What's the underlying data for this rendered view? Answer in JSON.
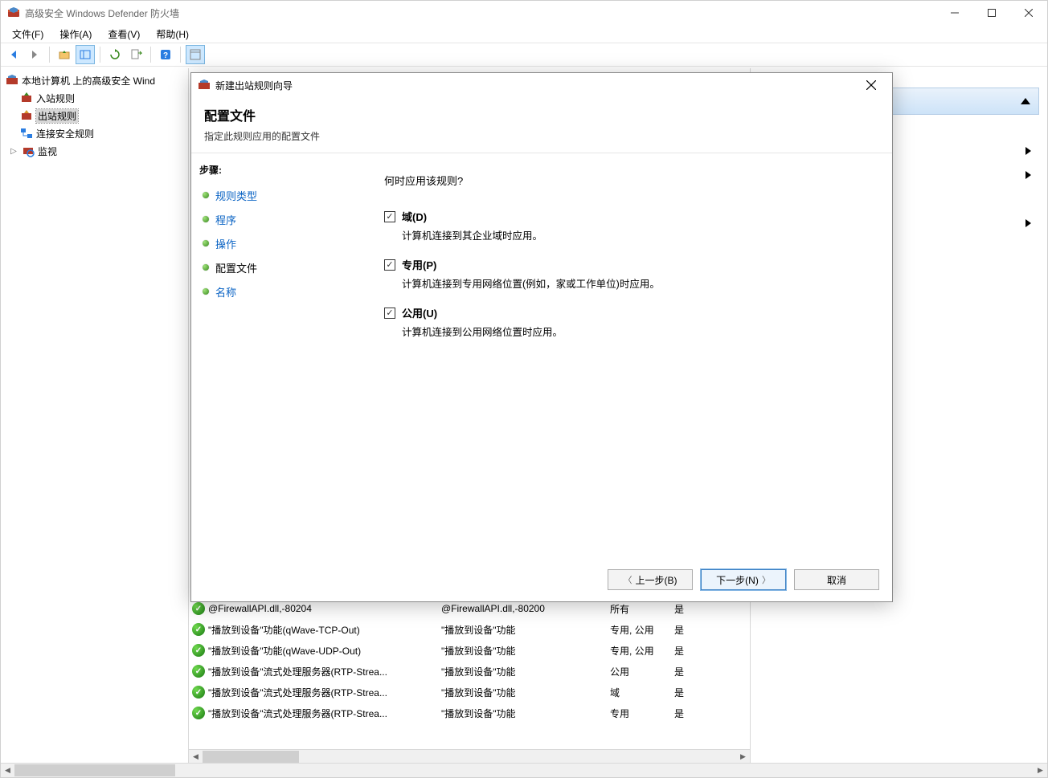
{
  "window": {
    "title": "高级安全 Windows Defender 防火墙"
  },
  "menu": {
    "file": "文件(F)",
    "action": "操作(A)",
    "view": "查看(V)",
    "help": "帮助(H)"
  },
  "tree": {
    "root": "本地计算机 上的高级安全 Wind",
    "inbound": "入站规则",
    "outbound": "出站规则",
    "connection": "连接安全规则",
    "monitor": "监视"
  },
  "rules": [
    {
      "name": "@FirewallAPI.dll,-80204",
      "group": "@FirewallAPI.dll,-80200",
      "profile": "所有",
      "enabled": "是"
    },
    {
      "name": "\"播放到设备\"功能(qWave-TCP-Out)",
      "group": "\"播放到设备\"功能",
      "profile": "专用, 公用",
      "enabled": "是"
    },
    {
      "name": "\"播放到设备\"功能(qWave-UDP-Out)",
      "group": "\"播放到设备\"功能",
      "profile": "专用, 公用",
      "enabled": "是"
    },
    {
      "name": "\"播放到设备\"流式处理服务器(RTP-Strea...",
      "group": "\"播放到设备\"功能",
      "profile": "公用",
      "enabled": "是"
    },
    {
      "name": "\"播放到设备\"流式处理服务器(RTP-Strea...",
      "group": "\"播放到设备\"功能",
      "profile": "域",
      "enabled": "是"
    },
    {
      "name": "\"播放到设备\"流式处理服务器(RTP-Strea...",
      "group": "\"播放到设备\"功能",
      "profile": "专用",
      "enabled": "是"
    }
  ],
  "wizard": {
    "title": "新建出站规则向导",
    "header": "配置文件",
    "subheader": "指定此规则应用的配置文件",
    "steps_title": "步骤:",
    "steps": {
      "rule_type": "规则类型",
      "program": "程序",
      "action": "操作",
      "profile": "配置文件",
      "name": "名称"
    },
    "question": "何时应用该规则?",
    "profiles": {
      "domain_label": "域(D)",
      "domain_desc": "计算机连接到其企业域时应用。",
      "private_label": "专用(P)",
      "private_desc": "计算机连接到专用网络位置(例如，家或工作单位)时应用。",
      "public_label": "公用(U)",
      "public_desc": "计算机连接到公用网络位置时应用。"
    },
    "buttons": {
      "back": "上一步(B)",
      "next": "下一步(N)",
      "cancel": "取消"
    }
  }
}
